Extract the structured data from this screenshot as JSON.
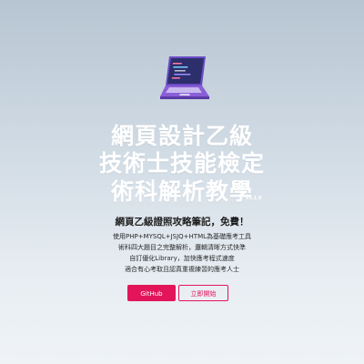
{
  "hero": {
    "title_lines": [
      "網頁設計乙級",
      "技術士技能檢定",
      "術科解析教學"
    ],
    "version": "v3.1.0",
    "subtitle": "網頁乙級證照攻略筆記，免費！",
    "description_lines": [
      "使用PHP+MYSQL+JSJQ+HTML為基礎應考工具",
      "術科四大題目之完整解析，邏輯清晰方式快準",
      "自訂優化Library，加快應考程式速度",
      "適合有心考取且認真重複練習的應考人士"
    ],
    "buttons": {
      "github_label": "GitHub",
      "start_label": "立即開始"
    },
    "icons": [
      "laptop-icon"
    ],
    "colors": {
      "accent": "#e2155a",
      "laptop_screen": "#2c2f6b",
      "laptop_body": "#8a5fd6"
    }
  }
}
